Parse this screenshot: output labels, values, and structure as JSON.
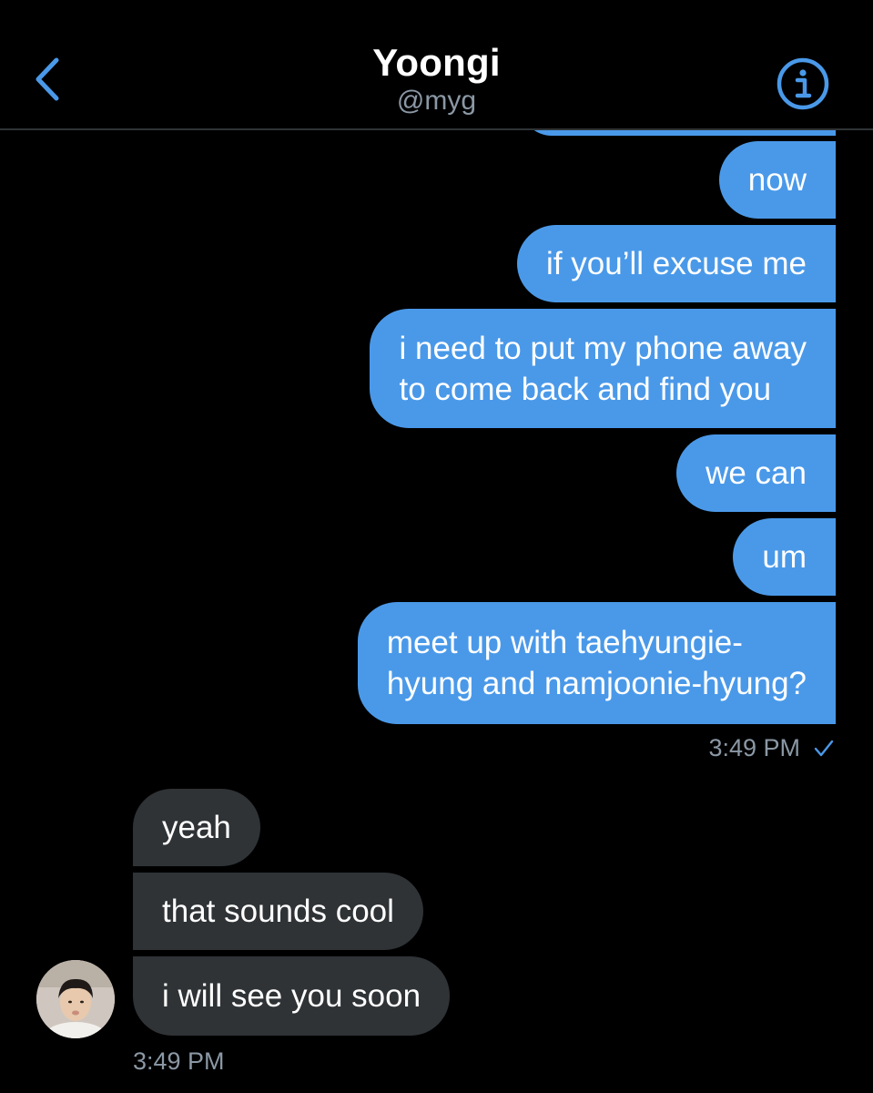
{
  "header": {
    "title": "Yoongi",
    "handle": "@myg",
    "back_icon": "chevron-left-icon",
    "info_icon": "info-icon",
    "accent_color": "#4a99e9"
  },
  "sent_messages": [
    {
      "text": "now"
    },
    {
      "text": "if you’ll excuse me"
    },
    {
      "text": "i need to put my phone away",
      "text2": "to come back and find you"
    },
    {
      "text": "we can"
    },
    {
      "text": "um"
    },
    {
      "text": "meet up with taehyungie-",
      "text2": "hyung and namjoonie-hyung?"
    }
  ],
  "sent_meta": {
    "time": "3:49 PM",
    "status_icon": "checkmark-icon"
  },
  "received_messages": [
    {
      "text": "yeah"
    },
    {
      "text": "that sounds cool"
    },
    {
      "text": "i will see you soon"
    }
  ],
  "received_meta": {
    "time": "3:49 PM"
  },
  "colors": {
    "sent_bubble": "#4a99e9",
    "received_bubble": "#2f3336",
    "background": "#000000",
    "secondary_text": "#8b98a5"
  }
}
